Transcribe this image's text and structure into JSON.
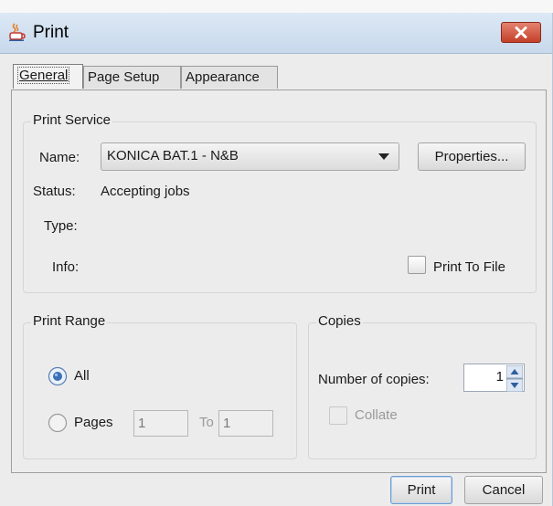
{
  "window": {
    "title": "Print"
  },
  "tabs": [
    {
      "label": "General",
      "active": true
    },
    {
      "label": "Page Setup",
      "active": false
    },
    {
      "label": "Appearance",
      "active": false
    }
  ],
  "print_service": {
    "group_title": "Print Service",
    "name_label": "Name:",
    "printer_name": "KONICA BAT.1 - N&B",
    "properties_label": "Properties...",
    "status_label": "Status:",
    "status_value": "Accepting jobs",
    "type_label": "Type:",
    "type_value": "",
    "info_label": "Info:",
    "info_value": "",
    "print_to_file_label": "Print To File",
    "print_to_file_checked": false
  },
  "print_range": {
    "group_title": "Print Range",
    "all_label": "All",
    "all_selected": true,
    "pages_label": "Pages",
    "pages_from": "1",
    "to_label": "To",
    "pages_to": "1"
  },
  "copies": {
    "group_title": "Copies",
    "number_label": "Number of copies:",
    "number_value": "1",
    "collate_label": "Collate",
    "collate_enabled": false
  },
  "footer": {
    "print_label": "Print",
    "cancel_label": "Cancel"
  },
  "colors": {
    "titlebar": "#c8d9ec",
    "close_button": "#c4402a",
    "default_button_border": "#6f9ccf",
    "radio_selected": "#3b6fb6"
  }
}
